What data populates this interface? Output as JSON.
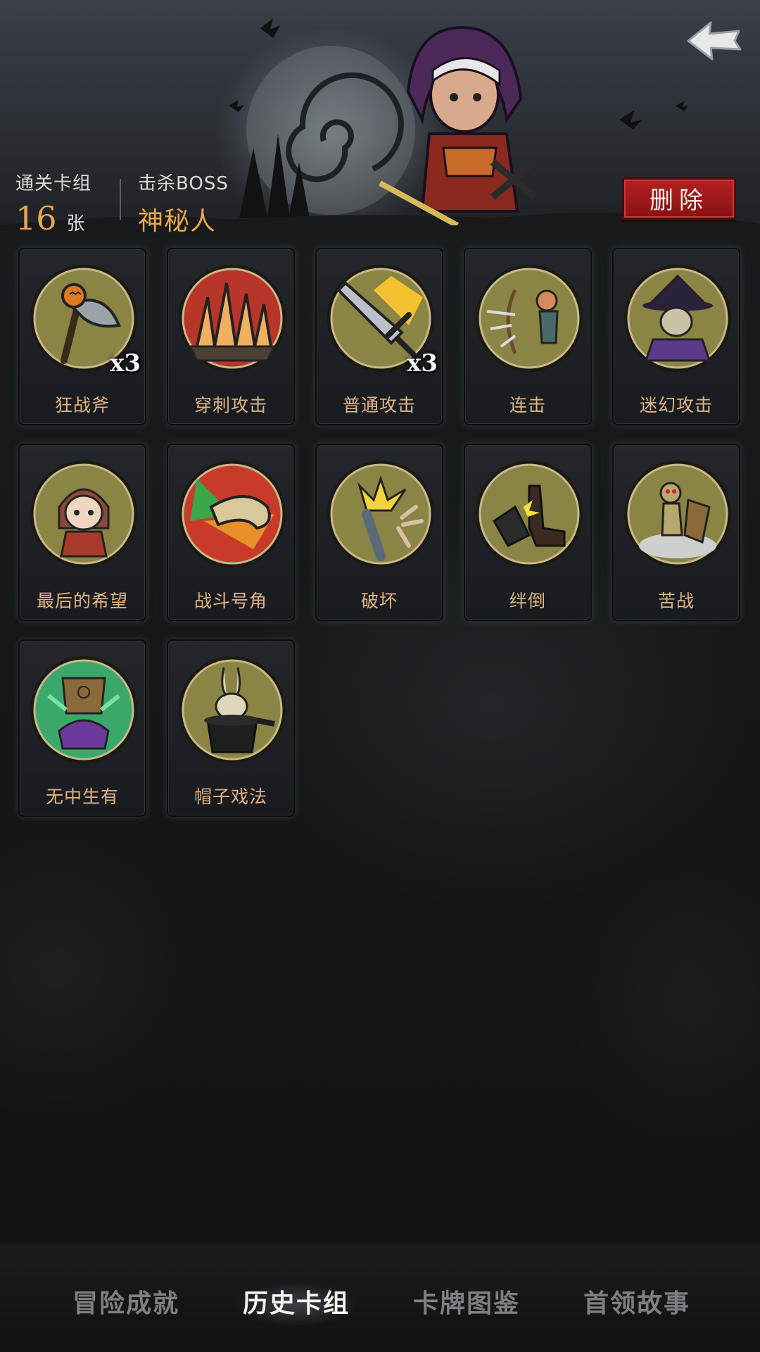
{
  "header": {
    "cleared_deck_label": "通关卡组",
    "cleared_deck_count": "16",
    "cleared_deck_unit": "张",
    "boss_label": "击杀BOSS",
    "boss_name": "神秘人",
    "delete_label": "删除",
    "back_icon": "back-arrow-icon"
  },
  "cards": [
    {
      "name": "狂战斧",
      "count": "x3",
      "icon": "pumpkin-axe-icon"
    },
    {
      "name": "穿刺攻击",
      "count": "",
      "icon": "spikes-icon"
    },
    {
      "name": "普通攻击",
      "count": "x3",
      "icon": "sword-icon"
    },
    {
      "name": "连击",
      "count": "",
      "icon": "archer-icon"
    },
    {
      "name": "迷幻攻击",
      "count": "",
      "icon": "witch-icon"
    },
    {
      "name": "最后的希望",
      "count": "",
      "icon": "girl-icon"
    },
    {
      "name": "战斗号角",
      "count": "",
      "icon": "war-horn-icon"
    },
    {
      "name": "破坏",
      "count": "",
      "icon": "broken-screw-icon"
    },
    {
      "name": "绊倒",
      "count": "",
      "icon": "trip-boot-icon"
    },
    {
      "name": "苦战",
      "count": "",
      "icon": "puppet-warrior-icon"
    },
    {
      "name": "无中生有",
      "count": "",
      "icon": "magic-box-icon"
    },
    {
      "name": "帽子戏法",
      "count": "",
      "icon": "rabbit-hat-icon"
    }
  ],
  "tabs": [
    {
      "label": "冒险成就",
      "active": false
    },
    {
      "label": "历史卡组",
      "active": true
    },
    {
      "label": "卡牌图鉴",
      "active": false
    },
    {
      "label": "首领故事",
      "active": false
    }
  ],
  "colors": {
    "accent_gold": "#e8a84a",
    "card_name": "#e2b483",
    "delete_red": "#9e1a1a",
    "icon_ring": "#8a8445"
  }
}
